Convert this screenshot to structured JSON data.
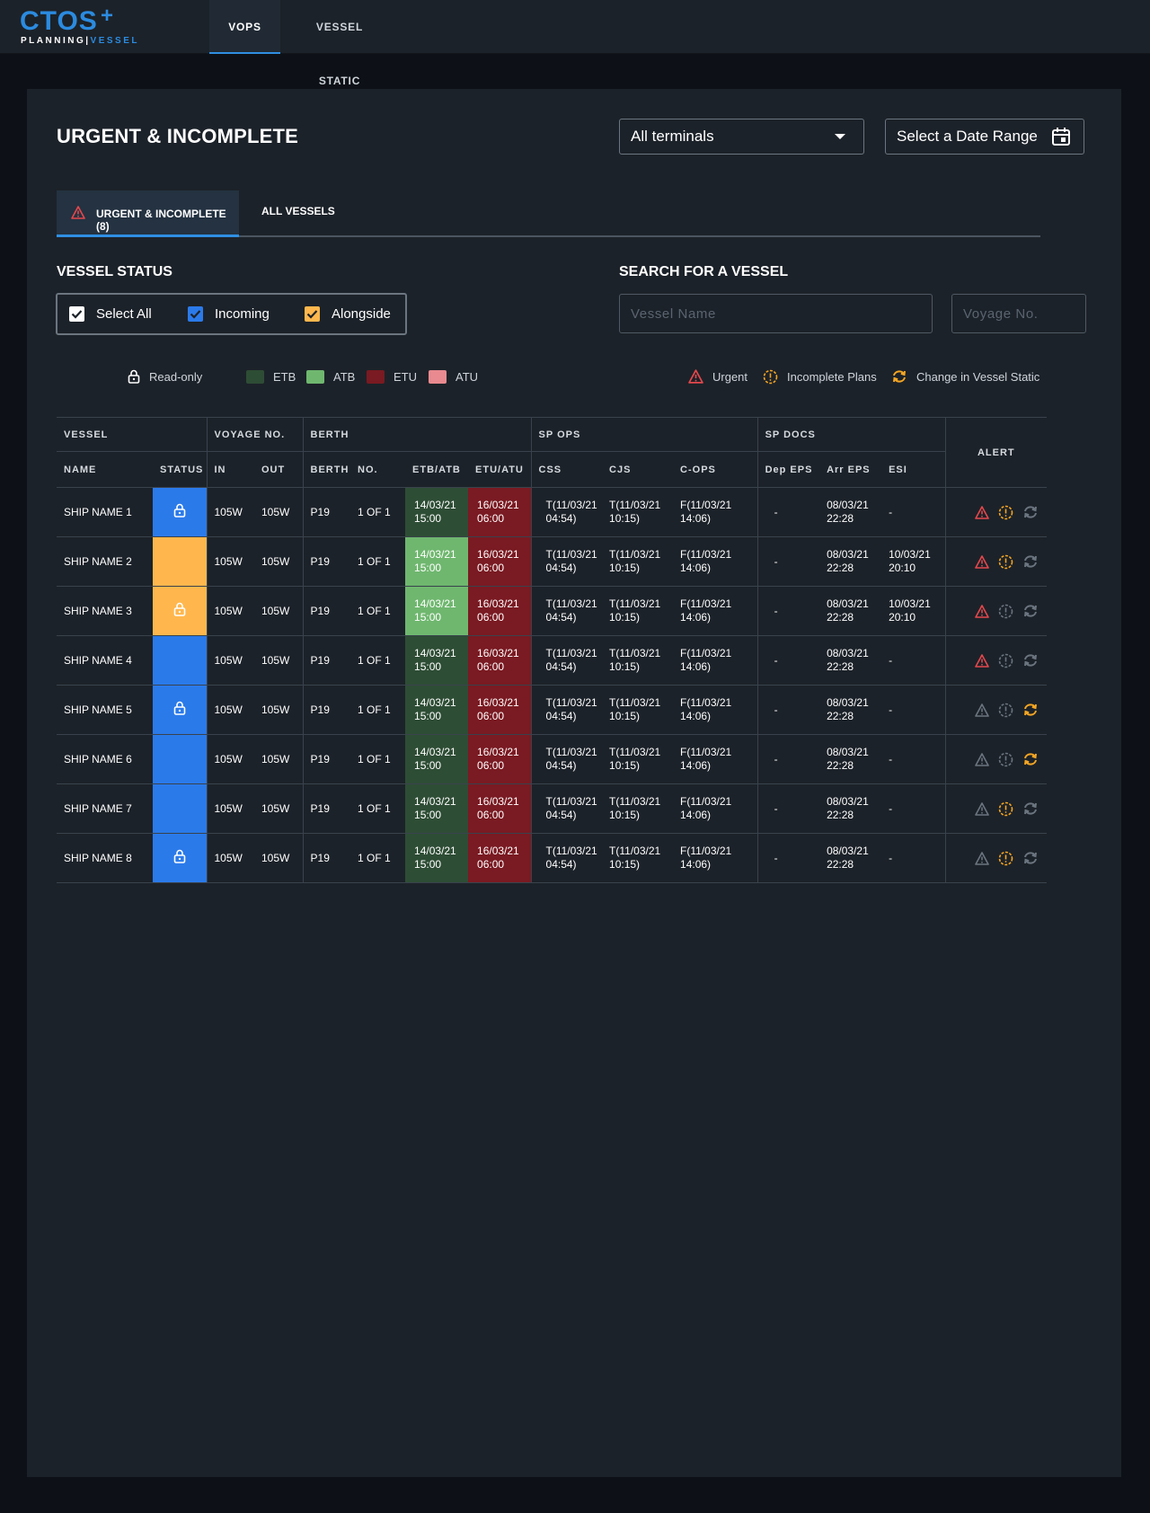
{
  "app": {
    "logo_text": "CTOS",
    "logo_plus": "+",
    "logo_sub_left": "PLANNING",
    "logo_sub_right": "VESSEL"
  },
  "nav": {
    "tabs": [
      {
        "label": "VOPS",
        "active": true
      },
      {
        "label": "VESSEL STATIC",
        "active": false
      }
    ]
  },
  "page": {
    "title": "URGENT & INCOMPLETE",
    "terminal_select": "All terminals",
    "date_range": "Select a Date Range",
    "tabs": [
      {
        "label": "URGENT & INCOMPLETE (8)",
        "active": true
      },
      {
        "label": "ALL VESSELS",
        "active": false
      }
    ],
    "vessel_status_label": "VESSEL STATUS",
    "search_label": "SEARCH FOR A VESSEL",
    "checkboxes": [
      {
        "label": "Select All",
        "checked": true,
        "color": "#ffffff"
      },
      {
        "label": "Incoming",
        "checked": true,
        "color": "#2b7aea"
      },
      {
        "label": "Alongside",
        "checked": true,
        "color": "#ffb74d"
      }
    ],
    "vessel_name_placeholder": "Vessel Name",
    "voyage_no_placeholder": "Voyage No."
  },
  "legend": {
    "readonly": "Read-only",
    "etb": "ETB",
    "atb": "ATB",
    "etu": "ETU",
    "atu": "ATU",
    "urgent": "Urgent",
    "incomplete": "Incomplete Plans",
    "change": "Change in Vessel Static",
    "colors": {
      "etb": "#2e4d35",
      "atb": "#6fb76f",
      "etu": "#7a1a22",
      "atu": "#e88a8f",
      "urgent": "#e5484d",
      "incomplete": "#f5a623",
      "inactive": "#6b7580"
    }
  },
  "table": {
    "groups": {
      "vessel": "VESSEL",
      "voyage": "VOYAGE NO.",
      "berth": "BERTH",
      "sp_ops": "SP OPS",
      "sp_docs": "SP DOCS",
      "alert": "ALERT"
    },
    "cols": {
      "name": "NAME",
      "status": "STATUS",
      "in": "IN",
      "out": "OUT",
      "berth": "BERTH",
      "no": "NO.",
      "etb_atb": "ETB/ATB",
      "etu_atu": "ETU/ATU",
      "css": "CSS",
      "cjs": "CJS",
      "c_ops": "C-OPS",
      "dep_eps": "Dep EPS",
      "arr_eps": "Arr EPS",
      "esi": "ESI"
    },
    "rows": [
      {
        "name": "SHIP NAME 1",
        "status": "incoming",
        "locked": true,
        "in": "105W",
        "out": "105W",
        "berth": "P19",
        "no": "1 OF 1",
        "etb_atb": [
          "14/03/21",
          "15:00"
        ],
        "etb_type": "etb",
        "etu_atu": [
          "16/03/21",
          "06:00"
        ],
        "css": [
          "T(11/03/21",
          "04:54)"
        ],
        "cjs": [
          "T(11/03/21",
          "10:15)"
        ],
        "c_ops": [
          "F(11/03/21",
          "14:06)"
        ],
        "dep_eps": "-",
        "arr_eps": [
          "08/03/21",
          "22:28"
        ],
        "esi": [
          "-",
          ""
        ],
        "urgent": true,
        "incomplete": true,
        "change": false
      },
      {
        "name": "SHIP NAME 2",
        "status": "alongside",
        "locked": false,
        "in": "105W",
        "out": "105W",
        "berth": "P19",
        "no": "1 OF 1",
        "etb_atb": [
          "14/03/21",
          "15:00"
        ],
        "etb_type": "atb",
        "etu_atu": [
          "16/03/21",
          "06:00"
        ],
        "css": [
          "T(11/03/21",
          "04:54)"
        ],
        "cjs": [
          "T(11/03/21",
          "10:15)"
        ],
        "c_ops": [
          "F(11/03/21",
          "14:06)"
        ],
        "dep_eps": "-",
        "arr_eps": [
          "08/03/21",
          "22:28"
        ],
        "esi": [
          "10/03/21",
          "20:10"
        ],
        "urgent": true,
        "incomplete": true,
        "change": false
      },
      {
        "name": "SHIP NAME 3",
        "status": "alongside",
        "locked": true,
        "in": "105W",
        "out": "105W",
        "berth": "P19",
        "no": "1 OF 1",
        "etb_atb": [
          "14/03/21",
          "15:00"
        ],
        "etb_type": "atb",
        "etu_atu": [
          "16/03/21",
          "06:00"
        ],
        "css": [
          "T(11/03/21",
          "04:54)"
        ],
        "cjs": [
          "T(11/03/21",
          "10:15)"
        ],
        "c_ops": [
          "F(11/03/21",
          "14:06)"
        ],
        "dep_eps": "-",
        "arr_eps": [
          "08/03/21",
          "22:28"
        ],
        "esi": [
          "10/03/21",
          "20:10"
        ],
        "urgent": true,
        "incomplete": false,
        "change": false
      },
      {
        "name": "SHIP NAME 4",
        "status": "incoming",
        "locked": false,
        "in": "105W",
        "out": "105W",
        "berth": "P19",
        "no": "1 OF 1",
        "etb_atb": [
          "14/03/21",
          "15:00"
        ],
        "etb_type": "etb",
        "etu_atu": [
          "16/03/21",
          "06:00"
        ],
        "css": [
          "T(11/03/21",
          "04:54)"
        ],
        "cjs": [
          "T(11/03/21",
          "10:15)"
        ],
        "c_ops": [
          "F(11/03/21",
          "14:06)"
        ],
        "dep_eps": "-",
        "arr_eps": [
          "08/03/21",
          "22:28"
        ],
        "esi": [
          "-",
          ""
        ],
        "urgent": true,
        "incomplete": false,
        "change": false
      },
      {
        "name": "SHIP NAME 5",
        "status": "incoming",
        "locked": true,
        "in": "105W",
        "out": "105W",
        "berth": "P19",
        "no": "1 OF 1",
        "etb_atb": [
          "14/03/21",
          "15:00"
        ],
        "etb_type": "etb",
        "etu_atu": [
          "16/03/21",
          "06:00"
        ],
        "css": [
          "T(11/03/21",
          "04:54)"
        ],
        "cjs": [
          "T(11/03/21",
          "10:15)"
        ],
        "c_ops": [
          "F(11/03/21",
          "14:06)"
        ],
        "dep_eps": "-",
        "arr_eps": [
          "08/03/21",
          "22:28"
        ],
        "esi": [
          "-",
          ""
        ],
        "urgent": false,
        "incomplete": false,
        "change": true
      },
      {
        "name": "SHIP NAME 6",
        "status": "incoming",
        "locked": false,
        "in": "105W",
        "out": "105W",
        "berth": "P19",
        "no": "1 OF 1",
        "etb_atb": [
          "14/03/21",
          "15:00"
        ],
        "etb_type": "etb",
        "etu_atu": [
          "16/03/21",
          "06:00"
        ],
        "css": [
          "T(11/03/21",
          "04:54)"
        ],
        "cjs": [
          "T(11/03/21",
          "10:15)"
        ],
        "c_ops": [
          "F(11/03/21",
          "14:06)"
        ],
        "dep_eps": "-",
        "arr_eps": [
          "08/03/21",
          "22:28"
        ],
        "esi": [
          "-",
          ""
        ],
        "urgent": false,
        "incomplete": false,
        "change": true
      },
      {
        "name": "SHIP NAME 7",
        "status": "incoming",
        "locked": false,
        "in": "105W",
        "out": "105W",
        "berth": "P19",
        "no": "1 OF 1",
        "etb_atb": [
          "14/03/21",
          "15:00"
        ],
        "etb_type": "etb",
        "etu_atu": [
          "16/03/21",
          "06:00"
        ],
        "css": [
          "T(11/03/21",
          "04:54)"
        ],
        "cjs": [
          "T(11/03/21",
          "10:15)"
        ],
        "c_ops": [
          "F(11/03/21",
          "14:06)"
        ],
        "dep_eps": "-",
        "arr_eps": [
          "08/03/21",
          "22:28"
        ],
        "esi": [
          "-",
          ""
        ],
        "urgent": false,
        "incomplete": true,
        "change": false
      },
      {
        "name": "SHIP NAME 8",
        "status": "incoming",
        "locked": true,
        "in": "105W",
        "out": "105W",
        "berth": "P19",
        "no": "1 OF 1",
        "etb_atb": [
          "14/03/21",
          "15:00"
        ],
        "etb_type": "etb",
        "etu_atu": [
          "16/03/21",
          "06:00"
        ],
        "css": [
          "T(11/03/21",
          "04:54)"
        ],
        "cjs": [
          "T(11/03/21",
          "10:15)"
        ],
        "c_ops": [
          "F(11/03/21",
          "14:06)"
        ],
        "dep_eps": "-",
        "arr_eps": [
          "08/03/21",
          "22:28"
        ],
        "esi": [
          "-",
          ""
        ],
        "urgent": false,
        "incomplete": true,
        "change": false
      }
    ]
  }
}
